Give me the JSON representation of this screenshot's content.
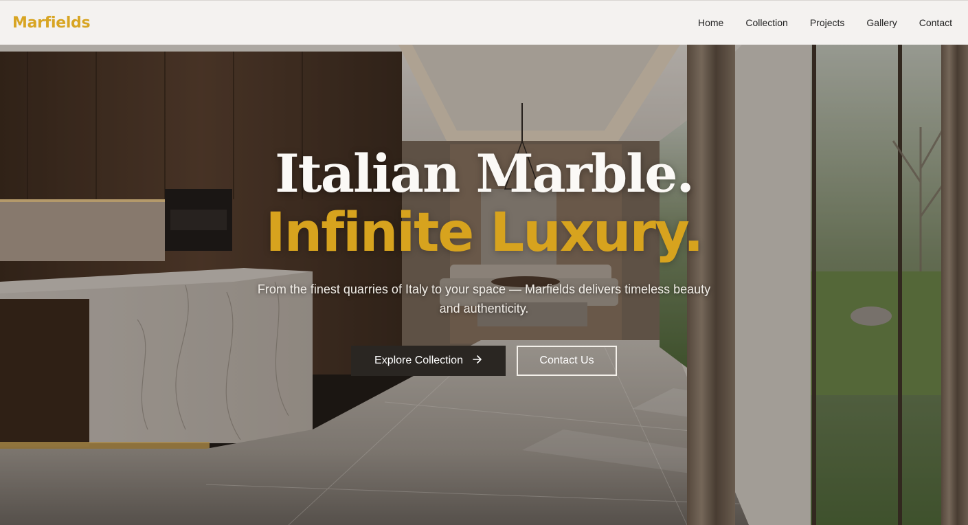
{
  "header": {
    "logo": "Marfields",
    "nav": [
      {
        "label": "Home"
      },
      {
        "label": "Collection"
      },
      {
        "label": "Projects"
      },
      {
        "label": "Gallery"
      },
      {
        "label": "Contact"
      }
    ]
  },
  "hero": {
    "headline_line1": "Italian Marble.",
    "headline_line2": "Infinite Luxury.",
    "subtext": "From the finest quarries of Italy to your space — Marfields delivers timeless beauty and authenticity.",
    "primary_button": {
      "label": "Explore Collection",
      "icon": "arrow-right-icon"
    },
    "secondary_button": {
      "label": "Contact Us"
    }
  },
  "colors": {
    "brand_gold": "#d7a31e",
    "header_bg": "#f4f2f0",
    "primary_button_bg": "#2a2622",
    "headline_white": "#fbf9f6"
  }
}
